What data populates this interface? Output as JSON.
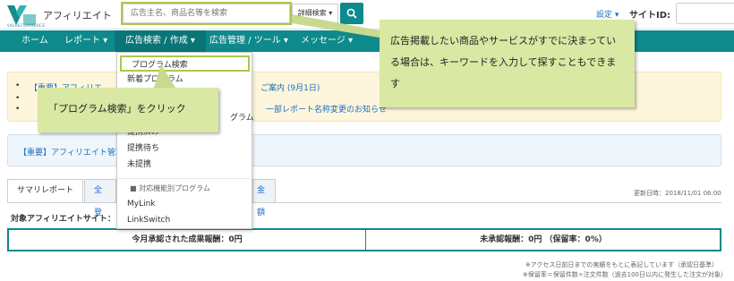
{
  "header": {
    "logo_text": "アフィリエイト",
    "logo_sub": "VALUECOMMERCE",
    "search_placeholder": "広告主名、商品名等を検索",
    "detail_search": "詳細検索 ▾",
    "settings": "設定 ▾",
    "site_id_label": "サイトID:",
    "search_icon": "search-icon"
  },
  "nav": {
    "items": [
      "ホーム",
      "レポート ▾",
      "広告検索 / 作成 ▾",
      "広告管理 / ツール ▾",
      "メッセージ ▾"
    ]
  },
  "dropdown": {
    "items": [
      "プログラム検索",
      "新着プログラム",
      "提携済み",
      "提携待ち",
      "未提携"
    ],
    "partial_item": "グラム",
    "group_label": "■ 対応機能別プログラム",
    "group_items": [
      "MyLink",
      "LinkSwitch"
    ]
  },
  "notices": {
    "line1_left": "【重要】アフィリエ",
    "line1_right": "ご案内 (9月1日)",
    "line3_right": "一部レポート名称変更のお知らせ",
    "important": "【重要】アフィリエイト管理"
  },
  "tabs": {
    "summary": "サマリレポート",
    "all_partial": "全登",
    "amount_partial": "金額"
  },
  "updated": "更新日時：2018/11/01 06:00",
  "target_label": "対象アフィリエイトサイト：",
  "summary": {
    "approved": "今月承認された成果報酬：0円",
    "unapproved": "未承認報酬：0円 （保留率：0%）"
  },
  "footnotes": {
    "line1": "※アクセス日前日までの実績をもとに表記しています（承認日基準）",
    "line2": "※保留率＝保留件数÷注文件数（過去100日以内に発生した注文が対象）"
  },
  "callouts": {
    "search_hint": "広告掲載したい商品やサービスがすでに決まっている場合は、キーワードを入力して探すこともできます",
    "click_hint": "「プログラム検索」をクリック"
  },
  "colors": {
    "brand_teal": "#0e8a8c",
    "link_blue": "#1a6fc2",
    "callout_green": "#d9e8a3",
    "highlight_green": "#a9c94a"
  }
}
